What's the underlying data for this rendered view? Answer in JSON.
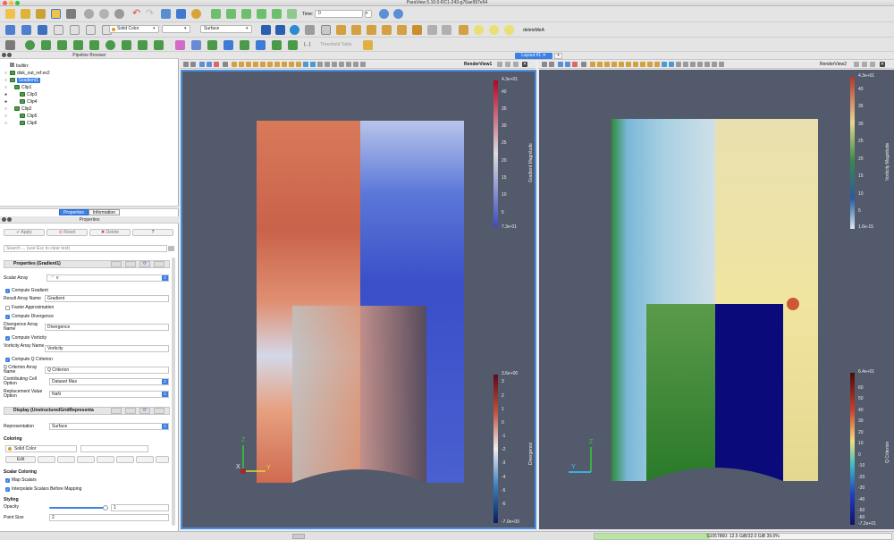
{
  "window": {
    "title": "ParaView 5.10.0-RC1-243-g76ae997e64"
  },
  "toolbar": {
    "time_label": "Time:",
    "time_value": "0",
    "time_index": "0",
    "coloring_select": "Solid Color",
    "component_select": "",
    "representation_select": "Surface",
    "macro_label": "deleteMeA",
    "threshold_table_label": "Threshold Table"
  },
  "pipeline_browser": {
    "title": "Pipeline Browser",
    "items": [
      {
        "label": "builtin:",
        "depth": 0,
        "visible": ""
      },
      {
        "label": "disk_out_ref.ex2",
        "depth": 1,
        "visible": "○"
      },
      {
        "label": "Gradient1",
        "depth": 1,
        "visible": "○",
        "selected": true
      },
      {
        "label": "Clip1",
        "depth": 2,
        "visible": "○"
      },
      {
        "label": "Clip3",
        "depth": 3,
        "visible": "●"
      },
      {
        "label": "Clip4",
        "depth": 3,
        "visible": "●"
      },
      {
        "label": "Clip2",
        "depth": 2,
        "visible": "○"
      },
      {
        "label": "Clip5",
        "depth": 3,
        "visible": "○"
      },
      {
        "label": "Clip6",
        "depth": 3,
        "visible": "○"
      }
    ]
  },
  "panel_tabs": {
    "properties": "Properties",
    "information": "Information"
  },
  "properties": {
    "title": "Properties",
    "apply": "Apply",
    "reset": "Reset",
    "delete": "Delete",
    "help": "?",
    "search_placeholder": "Search ... (use Esc to clear text)",
    "section_properties": "Properties (Gradient1)",
    "scalar_array_label": "Scalar Array",
    "scalar_array_value": "v",
    "compute_gradient": "Compute Gradient",
    "result_array_name_label": "Result Array Name",
    "result_array_name_value": "Gradient",
    "faster_approximation": "Faster Approximation",
    "compute_divergence": "Compute Divergence",
    "divergence_array_name_label": "Divergence Array Name",
    "divergence_array_name_value": "Divergence",
    "compute_vorticity": "Compute Vorticity",
    "vorticity_array_name_label": "Vorticity Array Name",
    "vorticity_array_name_value": "Vorticity",
    "compute_q_criterion": "Compute Q Criterion",
    "q_criterion_array_name_label": "Q Criterion Array Name",
    "q_criterion_array_name_value": "Q Criterion",
    "contributing_cell_label": "Contributing Cell Option",
    "contributing_cell_value": "Dataset Max",
    "replacement_value_label": "Replacement Value Option",
    "replacement_value_value": "NaN",
    "section_display": "Display (UnstructuredGridRepresenta",
    "representation_label": "Representation",
    "representation_value": "Surface",
    "coloring_heading": "Coloring",
    "coloring_value": "Solid Color",
    "edit_label": "Edit",
    "scalar_coloring_heading": "Scalar Coloring",
    "map_scalars": "Map Scalars",
    "interpolate_scalars": "Interpolate Scalars Before Mapping",
    "styling_heading": "Styling",
    "opacity_label": "Opacity",
    "opacity_value": "1",
    "point_size_label": "Point Size",
    "point_size_value": "2"
  },
  "layout": {
    "tab_label": "Layout #1",
    "add_tab": "+"
  },
  "view1": {
    "name": "RenderView1",
    "bar_top": {
      "title": "Gradient Magnitude",
      "max": "4.3e+01",
      "ticks": [
        "40",
        "35",
        "30",
        "25",
        "20",
        "15",
        "10",
        "5"
      ],
      "min": "7.3e-01"
    },
    "bar_bottom": {
      "title": "Divergence",
      "max": "3.6e+00",
      "ticks": [
        "3",
        "2",
        "1",
        "0",
        "-1",
        "-2",
        "-3",
        "-4",
        "-5",
        "-6"
      ],
      "min": "-7.0e+00"
    },
    "axes": {
      "z": "Z",
      "x": "X",
      "y": "Y"
    }
  },
  "view2": {
    "name": "RenderView2",
    "bar_top": {
      "title": "Vorticity Magnitude",
      "max": "4.3e+01",
      "ticks": [
        "40",
        "35",
        "30",
        "25",
        "20",
        "15",
        "10",
        "5"
      ],
      "min": "1.6e-15"
    },
    "bar_bottom": {
      "title": "Q Criterion",
      "max": "6.4e+01",
      "ticks": [
        "60",
        "50",
        "40",
        "30",
        "20",
        "10",
        "0",
        "-10",
        "-20",
        "-30",
        "-40",
        "-50",
        "-60"
      ],
      "min": "-7.2e+01"
    },
    "axes": {
      "z": "Z",
      "y": "Y"
    }
  },
  "status": {
    "memory": "S1057860: 12.5 GiB/32.0 GiB 39.0%",
    "memory_fraction": 0.39
  },
  "colors": {
    "accent": "#3b80e6",
    "view_bg": "#525a6b"
  }
}
